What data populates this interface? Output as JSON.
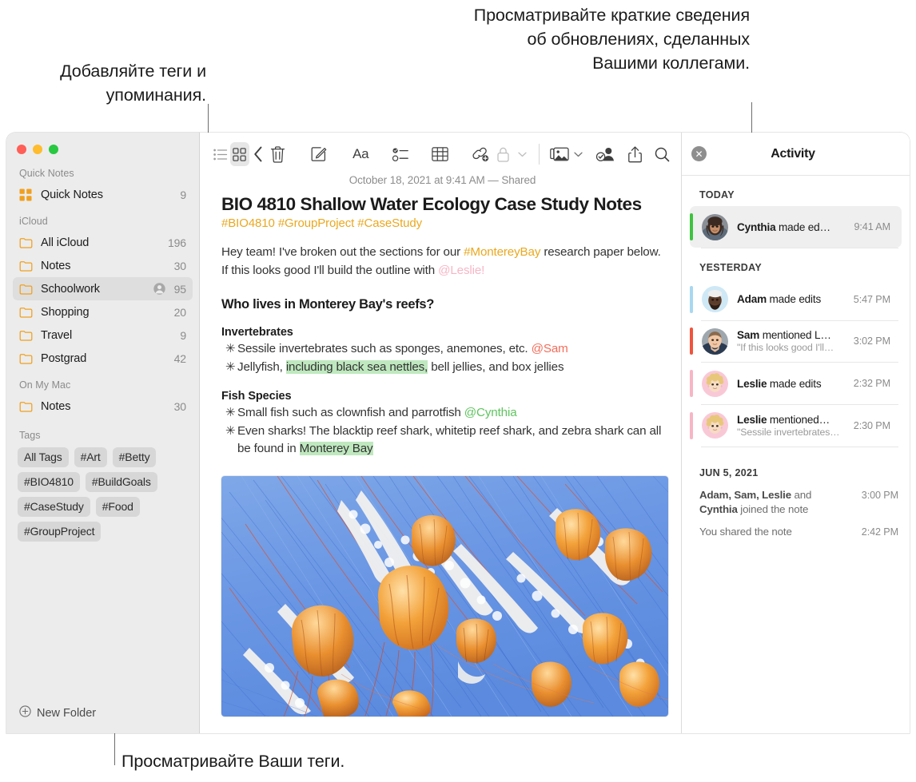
{
  "callouts": {
    "tags": "Добавляйте теги и упоминания.",
    "activity": "Просматривайте краткие сведения об обновлениях, сделанных Вашими коллегами.",
    "view_tags": "Просматривайте Ваши теги."
  },
  "sidebar": {
    "sections": [
      {
        "header": "Quick Notes",
        "items": [
          {
            "icon": "quicknotes-icon",
            "label": "Quick Notes",
            "count": "9",
            "shared": false,
            "selected": false
          }
        ]
      },
      {
        "header": "iCloud",
        "items": [
          {
            "icon": "folder-icon",
            "label": "All iCloud",
            "count": "196",
            "shared": false,
            "selected": false
          },
          {
            "icon": "folder-icon",
            "label": "Notes",
            "count": "30",
            "shared": false,
            "selected": false
          },
          {
            "icon": "folder-icon",
            "label": "Schoolwork",
            "count": "95",
            "shared": true,
            "selected": true
          },
          {
            "icon": "folder-icon",
            "label": "Shopping",
            "count": "20",
            "shared": false,
            "selected": false
          },
          {
            "icon": "folder-icon",
            "label": "Travel",
            "count": "9",
            "shared": false,
            "selected": false
          },
          {
            "icon": "folder-icon",
            "label": "Postgrad",
            "count": "42",
            "shared": false,
            "selected": false
          }
        ]
      },
      {
        "header": "On My Mac",
        "items": [
          {
            "icon": "folder-icon",
            "label": "Notes",
            "count": "30",
            "shared": false,
            "selected": false
          }
        ]
      }
    ],
    "tags_header": "Tags",
    "tags": [
      "All Tags",
      "#Art",
      "#Betty",
      "#BIO4810",
      "#BuildGoals",
      "#CaseStudy",
      "#Food",
      "#GroupProject"
    ],
    "new_folder_label": "New Folder"
  },
  "toolbar": {
    "left": [
      {
        "name": "list-view-icon",
        "label": "List View"
      },
      {
        "name": "gallery-view-icon",
        "label": "Gallery View"
      },
      {
        "name": "back-chevron-icon",
        "label": "Back"
      }
    ],
    "center": [
      {
        "name": "trash-icon",
        "label": "Delete"
      },
      {
        "name": "compose-icon",
        "label": "New Note"
      },
      {
        "name": "format-aa-icon",
        "label": "Format"
      },
      {
        "name": "checklist-icon",
        "label": "Checklist"
      },
      {
        "name": "table-icon",
        "label": "Table"
      },
      {
        "name": "link-add-icon",
        "label": "Add Link"
      }
    ],
    "right": [
      {
        "name": "lock-icon",
        "label": "Lock Note"
      },
      {
        "name": "media-icon",
        "label": "Media"
      },
      {
        "name": "collaborate-icon",
        "label": "Collaborate"
      },
      {
        "name": "share-icon",
        "label": "Share"
      },
      {
        "name": "search-icon",
        "label": "Search"
      }
    ]
  },
  "note": {
    "date": "October 18, 2021 at 9:41 AM — Shared",
    "title": "BIO 4810 Shallow Water Ecology Case Study Notes",
    "tagline": "#BIO4810 #GroupProject #CaseStudy",
    "intro_1": "Hey team! I've broken out the sections for our ",
    "intro_tag": "#MontereyBay",
    "intro_2": " research paper below. If this looks good I'll build the outline with ",
    "intro_mention": "@Leslie!",
    "section_heading": "Who lives in Monterey Bay's reefs?",
    "group1_heading": "Invertebrates",
    "g1_b1_text": "Sessile invertebrates such as sponges, anemones, etc. ",
    "g1_b1_mention": "@Sam",
    "g1_b2_pre": "Jellyfish, ",
    "g1_b2_hl": "including black sea nettles,",
    "g1_b2_post": " bell jellies, and box jellies",
    "group2_heading": "Fish Species",
    "g2_b1_text": "Small fish such as clownfish and parrotfish ",
    "g2_b1_mention": "@Cynthia",
    "g2_b2_pre": "Even sharks! The blacktip reef shark, whitetip reef shark, and zebra shark can all be found in ",
    "g2_b2_hl": "Monterey Bay",
    "bullet_glyph": "✳",
    "image_alt": "jellyfish-photo"
  },
  "activity": {
    "title": "Activity",
    "close_glyph": "✕",
    "groups": [
      {
        "label": "TODAY",
        "rows": [
          {
            "avatar": "cynthia-avatar",
            "bar_color": "#3fc33f",
            "name": "Cynthia",
            "action": " made ed…",
            "sub": "",
            "time": "9:41 AM",
            "selected": true
          }
        ]
      },
      {
        "label": "YESTERDAY",
        "rows": [
          {
            "avatar": "adam-avatar",
            "bar_color": "#a8d8f0",
            "name": "Adam",
            "action": " made edits",
            "sub": "",
            "time": "5:47 PM",
            "selected": false
          },
          {
            "avatar": "sam-avatar",
            "bar_color": "#f0533c",
            "name": "Sam",
            "action": " mentioned L…",
            "sub": "\"If this looks good I'll…",
            "time": "3:02 PM",
            "selected": false
          },
          {
            "avatar": "leslie-avatar",
            "bar_color": "#f7b6c6",
            "name": "Leslie",
            "action": " made edits",
            "sub": "",
            "time": "2:32 PM",
            "selected": false
          },
          {
            "avatar": "leslie-avatar",
            "bar_color": "#f7b6c6",
            "name": "Leslie",
            "action": " mentioned…",
            "sub": "\"Sessile invertebrates…",
            "time": "2:30 PM",
            "selected": false
          }
        ]
      }
    ],
    "older": {
      "label": "JUN 5, 2021",
      "rows": [
        {
          "bold": "Adam, Sam, Leslie",
          "mid": " and ",
          "bold2": "Cynthia",
          "rest": " joined the note",
          "time": "3:00 PM"
        },
        {
          "bold": "",
          "mid": "",
          "bold2": "",
          "rest": "You shared the note",
          "time": "2:42 PM"
        }
      ]
    }
  },
  "colors": {
    "accent_orange": "#eaa81f",
    "highlight_green": "#bfe8bf",
    "mention_pink": "#f7b6c6",
    "mention_red": "#f46d5a",
    "mention_green": "#5fc45f",
    "sidebar_bg": "#ececec",
    "selected_row": "#dedede"
  }
}
